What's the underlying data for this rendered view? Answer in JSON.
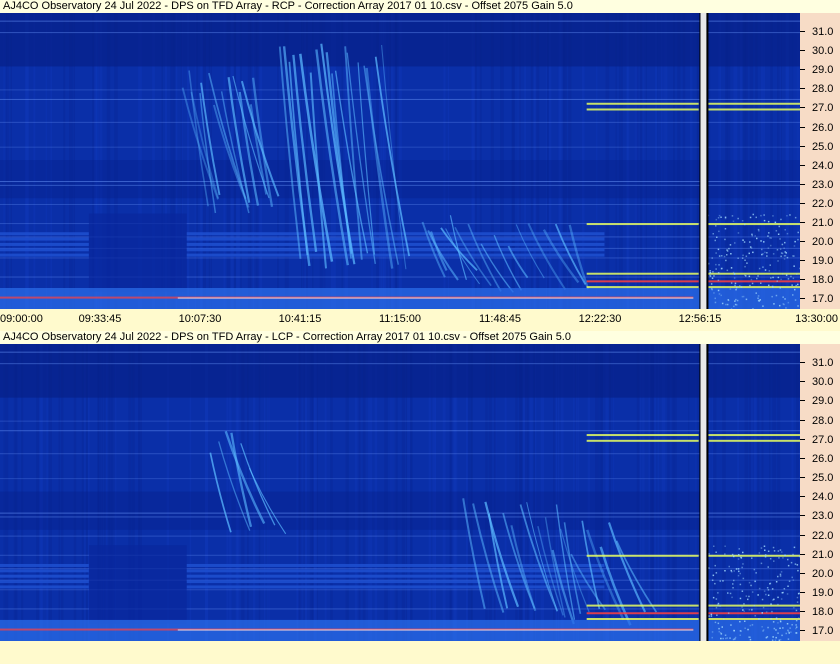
{
  "panels": [
    {
      "title": "AJ4CO Observatory 24 Jul 2022  -  DPS on TFD Array  -  RCP  -  Correction Array 2017 01 10.csv  -  Offset 2075  Gain 5.0",
      "polarization": "RCP",
      "show_time_axis": true
    },
    {
      "title": "AJ4CO Observatory 24 Jul 2022  -  DPS on TFD Array  -  LCP  -  Correction Array 2017 01 10.csv  -  Offset 2075  Gain 5.0",
      "polarization": "LCP",
      "show_time_axis": false
    }
  ],
  "chart_data": {
    "type": "heatmap",
    "y_ticks": [
      "31.0",
      "30.0",
      "29.0",
      "28.0",
      "27.0",
      "26.0",
      "25.0",
      "24.0",
      "23.0",
      "22.0",
      "21.0",
      "20.0",
      "19.0",
      "18.0",
      "17.0"
    ],
    "y_tick_values": [
      31,
      30,
      29,
      28,
      27,
      26,
      25,
      24,
      23,
      22,
      21,
      20,
      19,
      18,
      17
    ],
    "ylim": [
      16.5,
      32.0
    ],
    "x_ticks": [
      "09:00:00",
      "09:33:45",
      "10:07:30",
      "10:41:15",
      "11:15:00",
      "11:48:45",
      "12:22:30",
      "12:56:15",
      "13:30:00"
    ],
    "xlim_hours": [
      9.0,
      13.5
    ],
    "gap_hours": [
      12.94,
      12.98
    ],
    "colors": {
      "background": "#0a2fa8",
      "dark_band": "#061e86",
      "mid_band": "#1f50d0",
      "bright": "#5ab8ff",
      "gap": "#e8e8e8",
      "interference_yellow": "#e8ff60",
      "interference_red": "#ff4040"
    }
  }
}
